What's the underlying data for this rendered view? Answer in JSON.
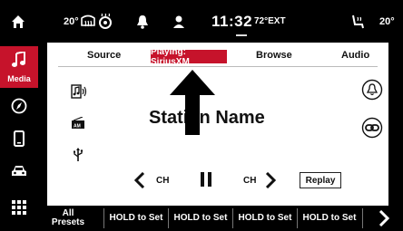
{
  "status_bar": {
    "left_temp": "20°",
    "clock": "11:32",
    "outside_temp": "72°EXT",
    "right_temp": "20°",
    "icons": [
      "home-icon",
      "rear-defrost-icon",
      "steering-wheel-heat-icon",
      "bell-icon",
      "driver-profile-icon",
      "seat-heat-icon"
    ]
  },
  "sidebar": {
    "items": [
      {
        "name": "media",
        "label": "Media",
        "icon": "music-note-icon",
        "active": true
      },
      {
        "name": "navigation",
        "label": "",
        "icon": "compass-icon"
      },
      {
        "name": "phone",
        "label": "",
        "icon": "phone-icon"
      },
      {
        "name": "vehicle",
        "label": "",
        "icon": "car-icon"
      },
      {
        "name": "apps",
        "label": "",
        "icon": "grid-icon"
      }
    ]
  },
  "tabs": {
    "source": "Source",
    "playing": "Playing: SiriusXM",
    "browse": "Browse",
    "audio": "Audio"
  },
  "main": {
    "station_name": "Station Name",
    "left_icons": [
      "music-info-icon",
      "radio-icon",
      "usb-icon"
    ],
    "right_icons": [
      "alert-bell-icon",
      "link-icon"
    ]
  },
  "controls": {
    "prev_label": "CH",
    "next_label": "CH",
    "replay": "Replay"
  },
  "presets": {
    "all_line1": "All",
    "all_line2": "Presets",
    "items": [
      "HOLD to Set",
      "HOLD to Set",
      "HOLD to Set",
      "HOLD to Set"
    ]
  },
  "colors": {
    "accent_red": "#c6132b",
    "background": "#000000",
    "panel": "#ffffff"
  }
}
